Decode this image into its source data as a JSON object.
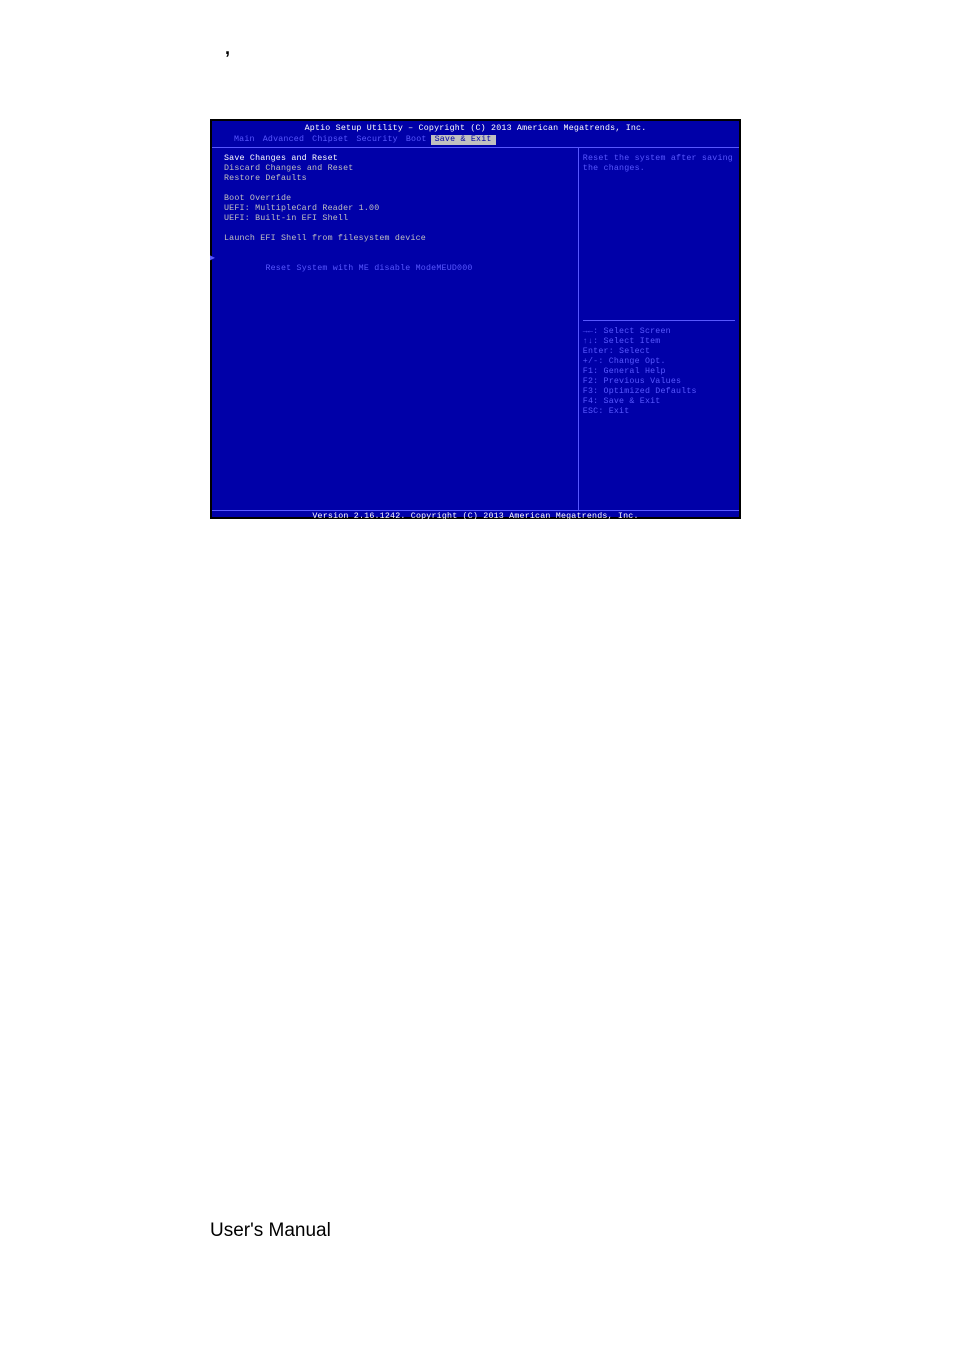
{
  "apostrophe": ",",
  "bios": {
    "title": "Aptio Setup Utility – Copyright (C) 2013 American Megatrends, Inc.",
    "tabs": {
      "main": "Main",
      "advanced": "Advanced",
      "chipset": "Chipset",
      "security": "Security",
      "boot": "Boot",
      "save_exit": "Save & Exit"
    },
    "left": {
      "save_changes_reset": "Save Changes and Reset",
      "discard_changes_reset": "Discard Changes and Reset",
      "restore_defaults": "Restore Defaults",
      "boot_override": "Boot Override",
      "uefi_card": "UEFI: MultipleCard Reader 1.00",
      "uefi_shell": "UEFI: Built-in EFI Shell",
      "launch_efi": "Launch EFI Shell from filesystem device",
      "reset_me": "Reset System with ME disable ModeMEUD000"
    },
    "right": {
      "help1": "Reset the system after saving",
      "help2": "the changes."
    },
    "keys": {
      "k1": "→←: Select Screen",
      "k2": "↑↓: Select Item",
      "k3": "Enter: Select",
      "k4": "+/-: Change Opt.",
      "k5": "F1: General Help",
      "k6": "F2: Previous Values",
      "k7": "F3: Optimized Defaults",
      "k8": "F4: Save & Exit",
      "k9": "ESC: Exit"
    },
    "footer": "Version 2.16.1242. Copyright (C) 2013 American Megatrends, Inc."
  },
  "user_manual": "User's Manual"
}
